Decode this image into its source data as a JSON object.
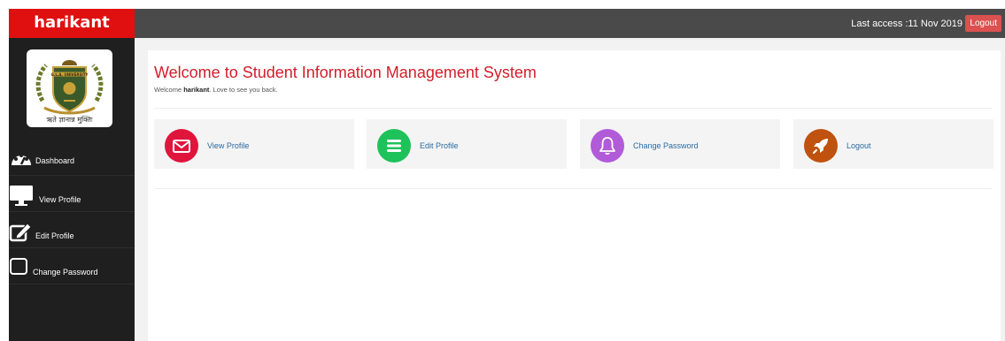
{
  "app": {
    "brand": "harikant"
  },
  "topbar": {
    "last_access": "Last access :11 Nov 2019",
    "logout_label": "Logout"
  },
  "sidebar": {
    "logo": {
      "top_text": "G.L.A. UNIVERSITY",
      "motto": "ऋते ज्ञानान्न मुक्तिः"
    },
    "items": [
      {
        "label": "Dashboard",
        "icon": "dashboard-icon"
      },
      {
        "label": "View Profile",
        "icon": "monitor-icon"
      },
      {
        "label": "Edit Profile",
        "icon": "edit-icon"
      },
      {
        "label": "Change Password",
        "icon": "square-icon"
      }
    ]
  },
  "main": {
    "title": "Welcome to Student Information Management System",
    "subtitle": {
      "prefix": "Welcome ",
      "user": "harikant",
      "suffix": ". Love to see you back."
    },
    "cards": [
      {
        "label": "View Profile",
        "icon": "envelope-icon",
        "color": "#e0153c"
      },
      {
        "label": "Edit Profile",
        "icon": "list-icon",
        "color": "#1ec25a"
      },
      {
        "label": "Change Password",
        "icon": "bell-icon",
        "color": "#b15bd9"
      },
      {
        "label": "Logout",
        "icon": "rocket-icon",
        "color": "#c0520f"
      }
    ]
  },
  "colors": {
    "brand_red": "#e01010",
    "topbar": "#4a4a4a",
    "sidebar": "#1f1f1f",
    "title_red": "#d21e2a",
    "logout_btn": "#dc5050"
  }
}
